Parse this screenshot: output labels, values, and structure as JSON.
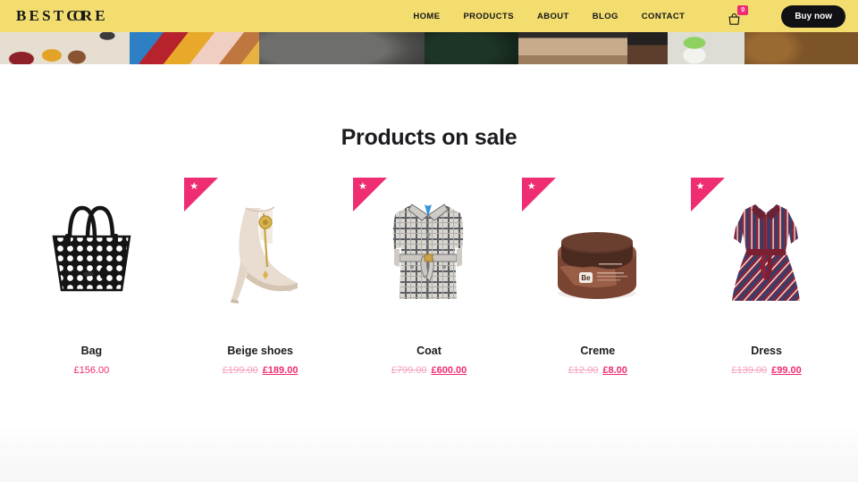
{
  "header": {
    "logo_text": "BESTCORE",
    "logo_parts": {
      "pre": "BEST",
      "oo": "CO",
      "post": "RE"
    },
    "nav": [
      {
        "label": "HOME",
        "name": "nav-home"
      },
      {
        "label": "PRODUCTS",
        "name": "nav-products"
      },
      {
        "label": "ABOUT",
        "name": "nav-about"
      },
      {
        "label": "BLOG",
        "name": "nav-blog"
      },
      {
        "label": "CONTACT",
        "name": "nav-contact"
      }
    ],
    "cart": {
      "icon": "shopping-bag-icon",
      "count": "0"
    },
    "buy_button": "Buy now",
    "background_color": "#f2dd6e",
    "accent_color": "#ee2d72"
  },
  "main": {
    "section_title": "Products on sale",
    "products": [
      {
        "name": "Bag",
        "on_sale": false,
        "badge_icon": "",
        "old_price": "",
        "price": "£156.00",
        "image_alt": "black-white-polka-dot-tote-bag"
      },
      {
        "name": "Beige shoes",
        "on_sale": true,
        "badge_icon": "star-icon",
        "old_price": "£199.00",
        "price": "£189.00",
        "image_alt": "beige-ankle-boot-stiletto-heel"
      },
      {
        "name": "Coat",
        "on_sale": true,
        "badge_icon": "star-icon",
        "old_price": "£799.00",
        "price": "£600.00",
        "image_alt": "grey-checked-belted-coat"
      },
      {
        "name": "Creme",
        "on_sale": true,
        "badge_icon": "star-icon",
        "old_price": "£12.00",
        "price": "£8.00",
        "image_alt": "brown-cosmetic-jar-scrub"
      },
      {
        "name": "Dress",
        "on_sale": true,
        "badge_icon": "star-icon",
        "old_price": "£139.00",
        "price": "£99.00",
        "image_alt": "red-blue-striped-shirt-dress"
      }
    ]
  }
}
